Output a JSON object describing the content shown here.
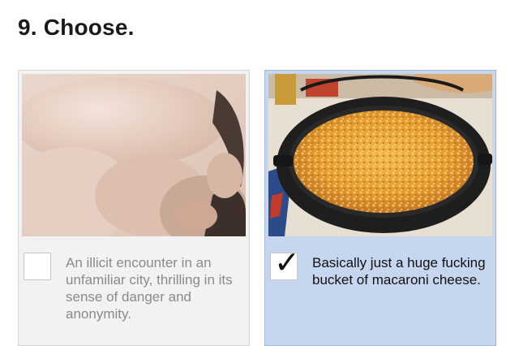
{
  "page": {
    "heading": "9. Choose."
  },
  "options": [
    {
      "image_subject": "embracing-couple-photo",
      "caption": "An illicit encounter in an unfamiliar city, thrilling in its sense of danger and anonymity.",
      "checked": false
    },
    {
      "image_subject": "pot-of-macaroni-cheese-photo",
      "caption": "Basically just a huge fucking bucket of macaroni cheese.",
      "checked": true,
      "check_symbol": "✓",
      "selected_background": "#c5d6ee"
    }
  ]
}
